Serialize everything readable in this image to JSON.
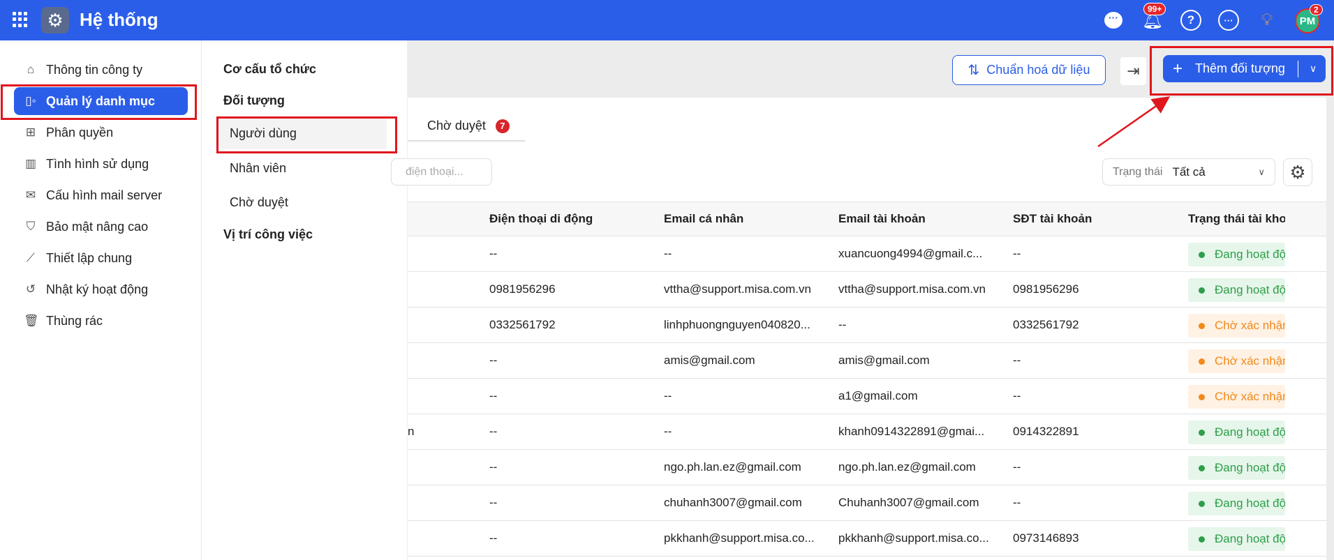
{
  "header": {
    "title": "Hệ thống",
    "notification_count": "99+",
    "avatar_initials": "PM",
    "avatar_badge": "2"
  },
  "sidebar": {
    "items": [
      {
        "label": "Thông tin công ty",
        "icon": "home-icon"
      },
      {
        "label": "Quản lý danh mục",
        "icon": "catalog-icon",
        "active": true
      },
      {
        "label": "Phân quyền",
        "icon": "permission-icon"
      },
      {
        "label": "Tình hình sử dụng",
        "icon": "bar-chart-icon"
      },
      {
        "label": "Cấu hình mail server",
        "icon": "mail-icon"
      },
      {
        "label": "Bảo mật nâng cao",
        "icon": "shield-icon"
      },
      {
        "label": "Thiết lập chung",
        "icon": "trend-icon"
      },
      {
        "label": "Nhật ký hoạt động",
        "icon": "history-icon"
      },
      {
        "label": "Thùng rác",
        "icon": "trash-icon"
      }
    ]
  },
  "submenu": {
    "org": "Cơ cấu tổ chức",
    "objects": "Đối tượng",
    "users": "Người dùng",
    "employees": "Nhân viên",
    "pending": "Chờ duyệt",
    "positions": "Vị trí công việc"
  },
  "toolbar": {
    "normalize": "Chuẩn hoá dữ liệu",
    "add": "Thêm đối tượng"
  },
  "tabs": {
    "pending": "Chờ duyệt",
    "pending_count": "7"
  },
  "search": {
    "placeholder": "điện thoại..."
  },
  "filter": {
    "label": "Trạng thái",
    "value": "Tất cả"
  },
  "table": {
    "columns": [
      "Điện thoại di động",
      "Email cá nhân",
      "Email tài khoản",
      "SĐT tài khoản",
      "Trạng thái tài khoản"
    ],
    "rows": [
      {
        "name": "",
        "phone": "--",
        "email": "--",
        "acc_email": "xuancuong4994@gmail.c...",
        "acc_phone": "--",
        "status": "Đang hoạt động",
        "kind": "active"
      },
      {
        "name": "",
        "phone": "0981956296",
        "email": "vttha@support.misa.com.vn",
        "acc_email": "vttha@support.misa.com.vn",
        "acc_phone": "0981956296",
        "status": "Đang hoạt động",
        "kind": "active"
      },
      {
        "name": "",
        "phone": "0332561792",
        "email": "linhphuongnguyen040820...",
        "acc_email": "--",
        "acc_phone": "0332561792",
        "status": "Chờ xác nhận",
        "kind": "pending"
      },
      {
        "name": "",
        "phone": "--",
        "email": "amis@gmail.com",
        "acc_email": "amis@gmail.com",
        "acc_phone": "--",
        "status": "Chờ xác nhận",
        "kind": "pending"
      },
      {
        "name": "",
        "phone": "--",
        "email": "--",
        "acc_email": "a1@gmail.com",
        "acc_phone": "--",
        "status": "Chờ xác nhận",
        "kind": "pending"
      },
      {
        "name": "n",
        "phone": "--",
        "email": "--",
        "acc_email": "khanh0914322891@gmai...",
        "acc_phone": "0914322891",
        "status": "Đang hoạt động",
        "kind": "active"
      },
      {
        "name": "",
        "phone": "--",
        "email": "ngo.ph.lan.ez@gmail.com",
        "acc_email": "ngo.ph.lan.ez@gmail.com",
        "acc_phone": "--",
        "status": "Đang hoạt động",
        "kind": "active"
      },
      {
        "name": "",
        "phone": "--",
        "email": "chuhanh3007@gmail.com",
        "acc_email": "Chuhanh3007@gmail.com",
        "acc_phone": "--",
        "status": "Đang hoạt động",
        "kind": "active"
      },
      {
        "name": "",
        "phone": "--",
        "email": "pkkhanh@support.misa.co...",
        "acc_email": "pkkhanh@support.misa.co...",
        "acc_phone": "0973146893",
        "status": "Đang hoạt động",
        "kind": "active"
      }
    ]
  },
  "colors": {
    "brand": "#2b5ee8",
    "highlight": "#e0161d",
    "active_bg": "#e6f6ea",
    "active_fg": "#2e9e4a",
    "pending_bg": "#fff1e4",
    "pending_fg": "#f08a1c"
  }
}
